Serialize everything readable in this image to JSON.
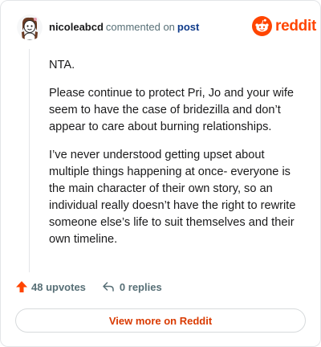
{
  "header": {
    "username": "nicoleabcd",
    "commented_on": "commented on",
    "post_link": "post",
    "brand": "reddit",
    "avatar_icon": "snoo-avatar-icon",
    "brand_icon": "reddit-snoo-icon"
  },
  "comment": {
    "paragraphs": [
      "NTA.",
      "Please continue to protect Pri, Jo and your wife seem to have the case of bridezilla and don’t appear to care about burning relationships.",
      "I’ve never understood getting upset about multiple things happening at once- everyone is the main character of their own story, so an individual really doesn’t have the right to rewrite someone else’s life to suit themselves and their own timeline."
    ]
  },
  "actions": {
    "upvotes": "48 upvotes",
    "replies": "0 replies",
    "upvote_icon": "upvote-arrow-icon",
    "reply_icon": "reply-arrow-icon"
  },
  "view_more": "View more on Reddit",
  "colors": {
    "brand": "#ff4500",
    "muted": "#576f76",
    "link": "#0f3b8a",
    "cta": "#d93a00"
  }
}
